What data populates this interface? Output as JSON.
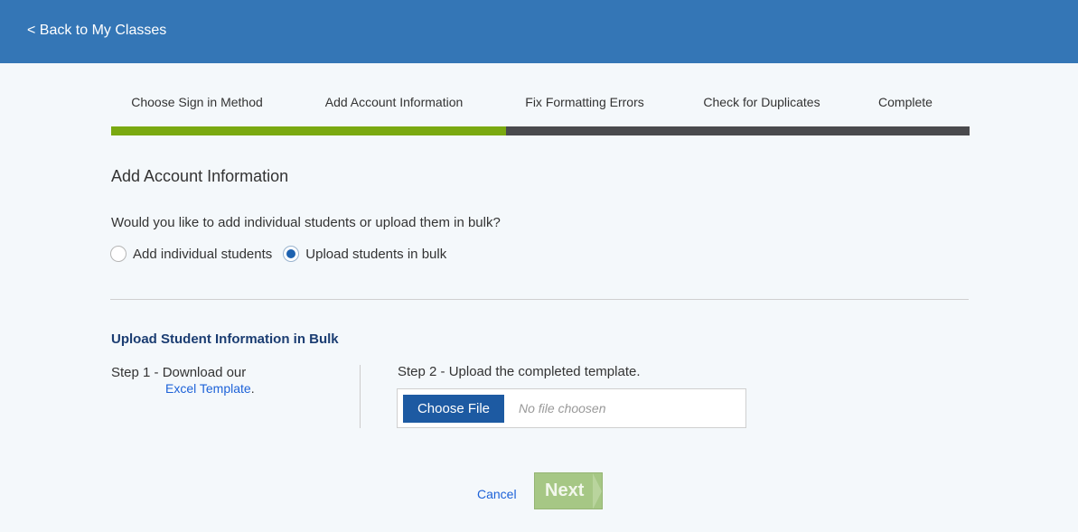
{
  "header": {
    "back_label": "< Back to My Classes"
  },
  "steps": [
    {
      "label": "Choose Sign in Method"
    },
    {
      "label": "Add Account Information"
    },
    {
      "label": "Fix Formatting Errors"
    },
    {
      "label": "Check for Duplicates"
    },
    {
      "label": "Complete"
    }
  ],
  "progress": {
    "completed_steps": 2,
    "total_steps": 5,
    "fraction": 0.46
  },
  "section": {
    "title": "Add Account Information",
    "question": "Would you like to add individual students or upload them in bulk?",
    "options": [
      {
        "label": "Add individual students",
        "checked": false
      },
      {
        "label": "Upload students in bulk",
        "checked": true
      }
    ]
  },
  "upload": {
    "title": "Upload Student Information in Bulk",
    "step1_text": "Step 1 - Download our",
    "template_link": "Excel Template",
    "template_suffix": ".",
    "step2_text": "Step 2 - Upload the completed template.",
    "choose_file_label": "Choose File",
    "file_placeholder": "No file choosen"
  },
  "actions": {
    "cancel_label": "Cancel",
    "next_label": "Next"
  },
  "colors": {
    "header_bg": "#3476b6",
    "progress_done": "#7aa910",
    "progress_remaining": "#4a4a4d",
    "primary_button": "#1d5aa2",
    "link": "#1d62d8",
    "next_disabled": "#a6c785"
  }
}
